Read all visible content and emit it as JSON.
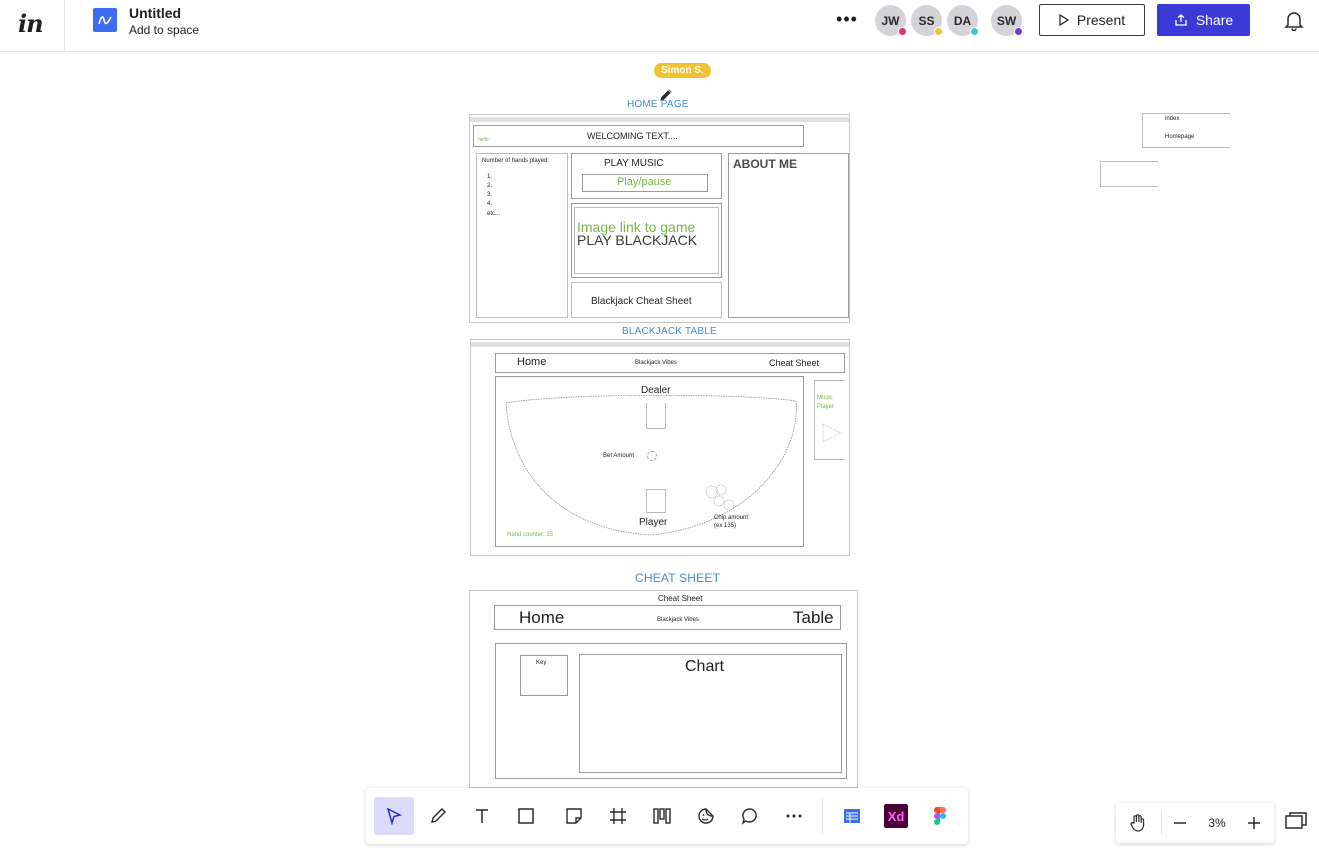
{
  "app": {
    "logo_text": "in",
    "doc_title": "Untitled",
    "doc_subtitle": "Add to space",
    "more_label": "•••",
    "present_label": "Present",
    "share_label": "Share",
    "avatars": [
      {
        "initials": "JW",
        "dot_color": "#e0336b"
      },
      {
        "initials": "SS",
        "dot_color": "#f2c230"
      },
      {
        "initials": "DA",
        "dot_color": "#38c9cf"
      },
      {
        "initials": "SW",
        "dot_color": "#7a35d6"
      }
    ],
    "accent_color": "#3a3ad6"
  },
  "canvas": {
    "cursor_user": "Simon S.",
    "frames": {
      "home": {
        "label": "HOME PAGE",
        "hello": "hello:",
        "welcome": "WELCOMING TEXT....",
        "hands_title": "Number of hands played:",
        "hands_items": [
          "1.",
          "2.",
          "3.",
          "4.",
          "etc..."
        ],
        "play_music": "PLAY MUSIC",
        "play_pause": "Play/pause",
        "image_link": "Image link to game",
        "play_blackjack": "PLAY BLACKJACK",
        "cheat_sheet": "Blackjack Cheat Sheet",
        "about": "ABOUT ME"
      },
      "table": {
        "label": "BLACKJACK TABLE",
        "nav_home": "Home",
        "nav_title": "Blackjack Vibes",
        "nav_cheat": "Cheat Sheet",
        "dealer": "Dealer",
        "bet": "Bet Amount",
        "player": "Player",
        "chips": "Chip amount",
        "chips_example": "(ex 135)",
        "hand_counter": "Hand counter: 35",
        "music": "Music",
        "player_word": "Player"
      },
      "cheat": {
        "label": "CHEAT SHEET",
        "top_title": "Cheat Sheet",
        "nav_home": "Home",
        "nav_title": "Blackjack Vibes",
        "nav_table": "Table",
        "key": "Key",
        "chart": "Chart"
      },
      "side": {
        "index": "index",
        "homepage": "Homepage"
      }
    }
  },
  "toolbar": {
    "tools": [
      "select-tool",
      "pen-tool",
      "text-tool",
      "rectangle-tool",
      "sticky-note-tool",
      "frame-tool",
      "components-tool",
      "sticker-tool",
      "comment-tool",
      "more-tools"
    ],
    "integrations": [
      "flowchart-app",
      "adobe-xd-app",
      "figma-app"
    ],
    "xd_label": "Xd"
  },
  "zoom": {
    "level": "3%"
  }
}
